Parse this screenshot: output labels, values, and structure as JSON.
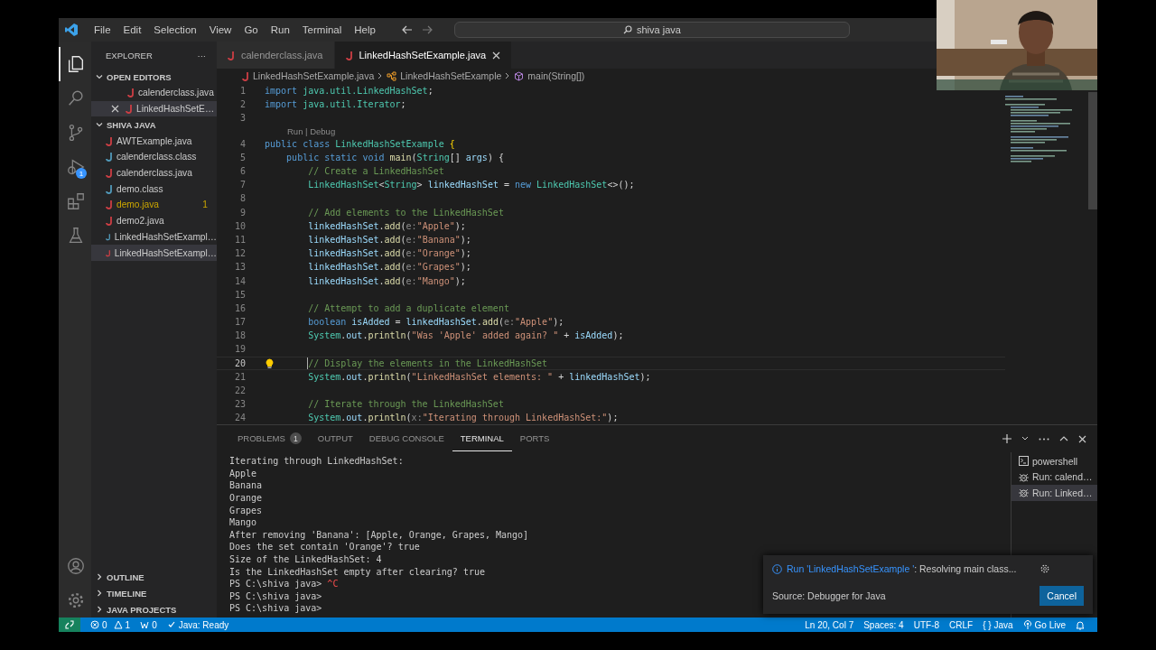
{
  "title_bar": {
    "menus": [
      "File",
      "Edit",
      "Selection",
      "View",
      "Go",
      "Run",
      "Terminal",
      "Help"
    ],
    "search": {
      "value": "shiva java"
    }
  },
  "activity_bar": [
    {
      "kind": "explorer",
      "selected": true
    },
    {
      "kind": "search",
      "selected": false
    },
    {
      "kind": "source-control",
      "selected": false
    },
    {
      "kind": "run",
      "selected": false,
      "badge": "1"
    },
    {
      "kind": "extensions",
      "selected": false
    },
    {
      "kind": "testing",
      "selected": false
    }
  ],
  "activity_bar_bottom": [
    {
      "kind": "account"
    },
    {
      "kind": "settings"
    }
  ],
  "sidebar": {
    "title": "EXPLORER",
    "more": "···",
    "open_editors": {
      "title": "OPEN EDITORS",
      "expanded": true,
      "items": [
        {
          "label": "calenderclass.java",
          "kind": "java",
          "selected": false
        },
        {
          "label": "LinkedHashSetE…",
          "kind": "java",
          "selected": true
        }
      ]
    },
    "folder": {
      "title": "SHIVA JAVA",
      "expanded": true,
      "items": [
        {
          "label": "AWTExample.java",
          "kind": "java",
          "selected": false,
          "warning": false
        },
        {
          "label": "calenderclass.class",
          "kind": "class",
          "selected": false,
          "warning": false
        },
        {
          "label": "calenderclass.java",
          "kind": "java",
          "selected": false,
          "warning": false
        },
        {
          "label": "demo.class",
          "kind": "class",
          "selected": false,
          "warning": false
        },
        {
          "label": "demo.java",
          "kind": "java",
          "selected": false,
          "warning": true,
          "problems": "1"
        },
        {
          "label": "demo2.java",
          "kind": "java",
          "selected": false,
          "warning": false
        },
        {
          "label": "LinkedHashSetExampl…",
          "kind": "class",
          "selected": false,
          "warning": false
        },
        {
          "label": "LinkedHashSetExampl…",
          "kind": "java",
          "selected": true,
          "warning": false
        }
      ]
    },
    "sections": [
      {
        "title": "OUTLINE",
        "expanded": false
      },
      {
        "title": "TIMELINE",
        "expanded": false
      },
      {
        "title": "JAVA PROJECTS",
        "expanded": false
      }
    ]
  },
  "tabs": [
    {
      "label": "calenderclass.java",
      "selected": false
    },
    {
      "label": "LinkedHashSetExample.java",
      "selected": true
    }
  ],
  "breadcrumb": [
    {
      "label": "LinkedHashSetExample.java",
      "kind": "file"
    },
    {
      "label": "LinkedHashSetExample",
      "kind": "class"
    },
    {
      "label": "main(String[])",
      "kind": "method"
    }
  ],
  "editor": {
    "lines": [
      {
        "number": "1",
        "current": false,
        "tokens": [
          {
            "text": "import ",
            "kind": "keyword"
          },
          {
            "text": "java.util.LinkedHashSet",
            "kind": "type"
          },
          {
            "text": ";",
            "kind": "plain"
          }
        ]
      },
      {
        "number": "2",
        "current": false,
        "tokens": [
          {
            "text": "import ",
            "kind": "keyword"
          },
          {
            "text": "java.util.Iterator",
            "kind": "type"
          },
          {
            "text": ";",
            "kind": "plain"
          }
        ]
      },
      {
        "number": "3",
        "current": false
      },
      {
        "number": "4",
        "current": false,
        "tokens": [
          {
            "text": "public class ",
            "kind": "keyword"
          },
          {
            "text": "LinkedHashSetExample",
            "kind": "type"
          },
          {
            "text": " {",
            "kind": "brace"
          }
        ],
        "lens": "Run | Debug"
      },
      {
        "number": "5",
        "current": false,
        "tokens": [
          {
            "text": "    public static void ",
            "kind": "keyword"
          },
          {
            "text": "main",
            "kind": "function"
          },
          {
            "text": "(",
            "kind": "plain"
          },
          {
            "text": "String",
            "kind": "type"
          },
          {
            "text": "[] ",
            "kind": "plain"
          },
          {
            "text": "args",
            "kind": "variable"
          },
          {
            "text": ") {",
            "kind": "plain"
          }
        ]
      },
      {
        "number": "6",
        "current": false,
        "tokens": [
          {
            "text": "        // Create a LinkedHashSet",
            "kind": "comment"
          }
        ]
      },
      {
        "number": "7",
        "current": false,
        "tokens": [
          {
            "text": "        LinkedHashSet",
            "kind": "type"
          },
          {
            "text": "<",
            "kind": "plain"
          },
          {
            "text": "String",
            "kind": "type"
          },
          {
            "text": "> ",
            "kind": "plain"
          },
          {
            "text": "linkedHashSet",
            "kind": "variable"
          },
          {
            "text": " = ",
            "kind": "plain"
          },
          {
            "text": "new ",
            "kind": "keyword"
          },
          {
            "text": "LinkedHashSet",
            "kind": "type"
          },
          {
            "text": "<>();",
            "kind": "plain"
          }
        ]
      },
      {
        "number": "8",
        "current": false
      },
      {
        "number": "9",
        "current": false,
        "tokens": [
          {
            "text": "        // Add elements to the LinkedHashSet",
            "kind": "comment"
          }
        ]
      },
      {
        "number": "10",
        "current": false,
        "tokens": [
          {
            "text": "        linkedHashSet",
            "kind": "variable"
          },
          {
            "text": ".",
            "kind": "plain"
          },
          {
            "text": "add",
            "kind": "function"
          },
          {
            "text": "(",
            "kind": "plain"
          },
          {
            "text": "e:",
            "kind": "hint"
          },
          {
            "text": "\"Apple\"",
            "kind": "string"
          },
          {
            "text": ");",
            "kind": "plain"
          }
        ]
      },
      {
        "number": "11",
        "current": false,
        "tokens": [
          {
            "text": "        linkedHashSet",
            "kind": "variable"
          },
          {
            "text": ".",
            "kind": "plain"
          },
          {
            "text": "add",
            "kind": "function"
          },
          {
            "text": "(",
            "kind": "plain"
          },
          {
            "text": "e:",
            "kind": "hint"
          },
          {
            "text": "\"Banana\"",
            "kind": "string"
          },
          {
            "text": ");",
            "kind": "plain"
          }
        ]
      },
      {
        "number": "12",
        "current": false,
        "tokens": [
          {
            "text": "        linkedHashSet",
            "kind": "variable"
          },
          {
            "text": ".",
            "kind": "plain"
          },
          {
            "text": "add",
            "kind": "function"
          },
          {
            "text": "(",
            "kind": "plain"
          },
          {
            "text": "e:",
            "kind": "hint"
          },
          {
            "text": "\"Orange\"",
            "kind": "string"
          },
          {
            "text": ");",
            "kind": "plain"
          }
        ]
      },
      {
        "number": "13",
        "current": false,
        "tokens": [
          {
            "text": "        linkedHashSet",
            "kind": "variable"
          },
          {
            "text": ".",
            "kind": "plain"
          },
          {
            "text": "add",
            "kind": "function"
          },
          {
            "text": "(",
            "kind": "plain"
          },
          {
            "text": "e:",
            "kind": "hint"
          },
          {
            "text": "\"Grapes\"",
            "kind": "string"
          },
          {
            "text": ");",
            "kind": "plain"
          }
        ]
      },
      {
        "number": "14",
        "current": false,
        "tokens": [
          {
            "text": "        linkedHashSet",
            "kind": "variable"
          },
          {
            "text": ".",
            "kind": "plain"
          },
          {
            "text": "add",
            "kind": "function"
          },
          {
            "text": "(",
            "kind": "plain"
          },
          {
            "text": "e:",
            "kind": "hint"
          },
          {
            "text": "\"Mango\"",
            "kind": "string"
          },
          {
            "text": ");",
            "kind": "plain"
          }
        ]
      },
      {
        "number": "15",
        "current": false
      },
      {
        "number": "16",
        "current": false,
        "tokens": [
          {
            "text": "        // Attempt to add a duplicate element",
            "kind": "comment"
          }
        ]
      },
      {
        "number": "17",
        "current": false,
        "tokens": [
          {
            "text": "        boolean ",
            "kind": "keyword"
          },
          {
            "text": "isAdded",
            "kind": "variable"
          },
          {
            "text": " = ",
            "kind": "plain"
          },
          {
            "text": "linkedHashSet",
            "kind": "variable"
          },
          {
            "text": ".",
            "kind": "plain"
          },
          {
            "text": "add",
            "kind": "function"
          },
          {
            "text": "(",
            "kind": "plain"
          },
          {
            "text": "e:",
            "kind": "hint"
          },
          {
            "text": "\"Apple\"",
            "kind": "string"
          },
          {
            "text": ");",
            "kind": "plain"
          }
        ]
      },
      {
        "number": "18",
        "current": false,
        "tokens": [
          {
            "text": "        System",
            "kind": "type"
          },
          {
            "text": ".",
            "kind": "plain"
          },
          {
            "text": "out",
            "kind": "variable"
          },
          {
            "text": ".",
            "kind": "plain"
          },
          {
            "text": "println",
            "kind": "function"
          },
          {
            "text": "(",
            "kind": "plain"
          },
          {
            "text": "\"Was 'Apple' added again? \"",
            "kind": "string"
          },
          {
            "text": " + ",
            "kind": "plain"
          },
          {
            "text": "isAdded",
            "kind": "variable"
          },
          {
            "text": ");",
            "kind": "plain"
          }
        ]
      },
      {
        "number": "19",
        "current": false
      },
      {
        "number": "20",
        "current": true,
        "tokens": [
          {
            "text": "        // Display the elements in the LinkedHashSet",
            "kind": "comment"
          }
        ]
      },
      {
        "number": "21",
        "current": false,
        "tokens": [
          {
            "text": "        System",
            "kind": "type"
          },
          {
            "text": ".",
            "kind": "plain"
          },
          {
            "text": "out",
            "kind": "variable"
          },
          {
            "text": ".",
            "kind": "plain"
          },
          {
            "text": "println",
            "kind": "function"
          },
          {
            "text": "(",
            "kind": "plain"
          },
          {
            "text": "\"LinkedHashSet elements: \"",
            "kind": "string"
          },
          {
            "text": " + ",
            "kind": "plain"
          },
          {
            "text": "linkedHashSet",
            "kind": "variable"
          },
          {
            "text": ");",
            "kind": "plain"
          }
        ]
      },
      {
        "number": "22",
        "current": false
      },
      {
        "number": "23",
        "current": false,
        "tokens": [
          {
            "text": "        // Iterate through the LinkedHashSet",
            "kind": "comment"
          }
        ]
      },
      {
        "number": "24",
        "current": false,
        "tokens": [
          {
            "text": "        System",
            "kind": "type"
          },
          {
            "text": ".",
            "kind": "plain"
          },
          {
            "text": "out",
            "kind": "variable"
          },
          {
            "text": ".",
            "kind": "plain"
          },
          {
            "text": "println",
            "kind": "function"
          },
          {
            "text": "(",
            "kind": "plain"
          },
          {
            "text": "x:",
            "kind": "hint"
          },
          {
            "text": "\"Iterating through LinkedHashSet:\"",
            "kind": "string"
          },
          {
            "text": ");",
            "kind": "plain"
          }
        ]
      }
    ]
  },
  "panel": {
    "tabs": [
      {
        "label": "PROBLEMS",
        "selected": false,
        "badge": "1"
      },
      {
        "label": "OUTPUT",
        "selected": false
      },
      {
        "label": "DEBUG CONSOLE",
        "selected": false
      },
      {
        "label": "TERMINAL",
        "selected": true
      },
      {
        "label": "PORTS",
        "selected": false
      }
    ],
    "terminal_lines": [
      {
        "kind": "output",
        "text": "Iterating through LinkedHashSet:"
      },
      {
        "kind": "output",
        "text": "Apple"
      },
      {
        "kind": "output",
        "text": "Banana"
      },
      {
        "kind": "output",
        "text": "Orange"
      },
      {
        "kind": "output",
        "text": "Grapes"
      },
      {
        "kind": "output",
        "text": "Mango"
      },
      {
        "kind": "output",
        "text": "After removing 'Banana': [Apple, Orange, Grapes, Mango]"
      },
      {
        "kind": "output",
        "text": "Does the set contain 'Orange'? true"
      },
      {
        "kind": "output",
        "text": "Size of the LinkedHashSet: 4"
      },
      {
        "kind": "output",
        "text": "Is the LinkedHashSet empty after clearing? true"
      },
      {
        "kind": "prompt",
        "text": "PS C:\\shiva java>",
        "input": "^C"
      },
      {
        "kind": "prompt",
        "text": "PS C:\\shiva java>"
      },
      {
        "kind": "prompt",
        "text": "PS C:\\shiva java>"
      }
    ],
    "terminals": [
      {
        "label": "powershell",
        "kind": "shell",
        "selected": false
      },
      {
        "label": "Run: calend…",
        "kind": "run",
        "selected": false
      },
      {
        "label": "Run: Linked…",
        "kind": "run",
        "selected": true
      }
    ]
  },
  "notification": {
    "link": "Run 'LinkedHashSetExample '",
    "message": ": Resolving main class...",
    "source": "Source: Debugger for Java",
    "button": "Cancel"
  },
  "status_bar": {
    "errors": "0",
    "warnings": "1",
    "ports": "0",
    "java_status": "Java: Ready",
    "position": "Ln 20, Col 7",
    "indent": "Spaces: 4",
    "encoding": "UTF-8",
    "line_ending": "CRLF",
    "language_icon": "{ }",
    "language": "Java",
    "go_live": "Go Live"
  }
}
